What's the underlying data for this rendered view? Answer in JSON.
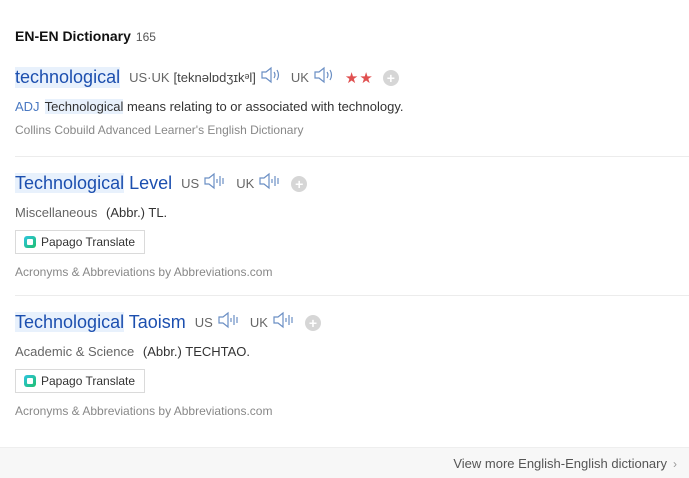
{
  "header": {
    "title": "EN-EN Dictionary",
    "count": "165"
  },
  "entries": [
    {
      "word": "technological",
      "pron_us_uk_label": "US·UK",
      "pronunciation": "[teknəlɒdʒɪkᵊl]",
      "uk_label": "UK",
      "stars": "★★",
      "pos": "ADJ",
      "meaning_highlight": "Technological",
      "meaning_rest": " means relating to or associated with technology.",
      "source": "Collins Cobuild Advanced Learner's English Dictionary"
    },
    {
      "word": "Technological Level",
      "us_label": "US",
      "uk_label": "UK",
      "category": "Miscellaneous",
      "meaning": "(Abbr.) TL.",
      "papago_label": "Papago Translate",
      "source": "Acronyms & Abbreviations by Abbreviations.com"
    },
    {
      "word": "Technological Taoism",
      "us_label": "US",
      "uk_label": "UK",
      "category": "Academic & Science",
      "meaning": "(Abbr.) TECHTAO.",
      "papago_label": "Papago Translate",
      "source": "Acronyms & Abbreviations by Abbreviations.com"
    }
  ],
  "footer": {
    "view_more": "View more English-English dictionary",
    "chevron": "›"
  },
  "icons": {
    "speaker": "speaker-icon",
    "plus": "plus-icon",
    "papago": "papago-logo-icon"
  },
  "colors": {
    "link_blue": "#1c4faf",
    "highlight": "#e8f1fc",
    "star_red": "#e05050"
  }
}
